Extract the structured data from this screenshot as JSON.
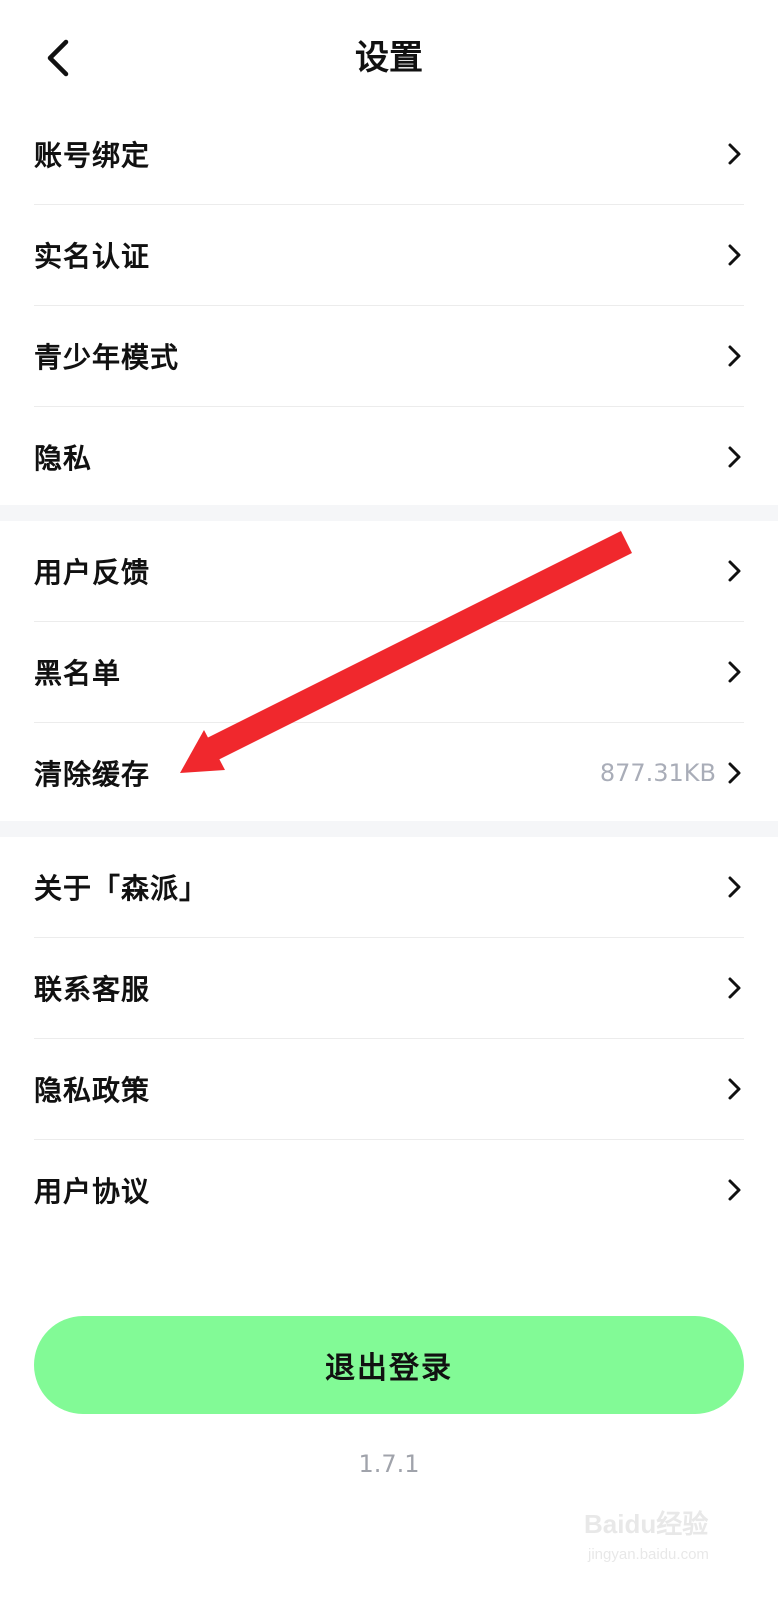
{
  "header": {
    "title": "设置",
    "back_icon": "chevron-left-icon"
  },
  "groups": [
    {
      "items": [
        {
          "label": "账号绑定",
          "value": ""
        },
        {
          "label": "实名认证",
          "value": ""
        },
        {
          "label": "青少年模式",
          "value": ""
        },
        {
          "label": "隐私",
          "value": ""
        }
      ]
    },
    {
      "items": [
        {
          "label": "用户反馈",
          "value": ""
        },
        {
          "label": "黑名单",
          "value": ""
        },
        {
          "label": "清除缓存",
          "value": "877.31KB"
        }
      ]
    },
    {
      "items": [
        {
          "label": "关于「森派」",
          "value": ""
        },
        {
          "label": "联系客服",
          "value": ""
        },
        {
          "label": "隐私政策",
          "value": ""
        },
        {
          "label": "用户协议",
          "value": ""
        }
      ]
    }
  ],
  "logout_label": "退出登录",
  "version": "1.7.1",
  "watermark": {
    "brand": "Baidu经验",
    "url": "jingyan.baidu.com"
  },
  "colors": {
    "logout_bg": "#82fa96",
    "separator": "#f5f6f8",
    "annotation_arrow": "#f0282d",
    "muted_text": "#a9adb8"
  }
}
